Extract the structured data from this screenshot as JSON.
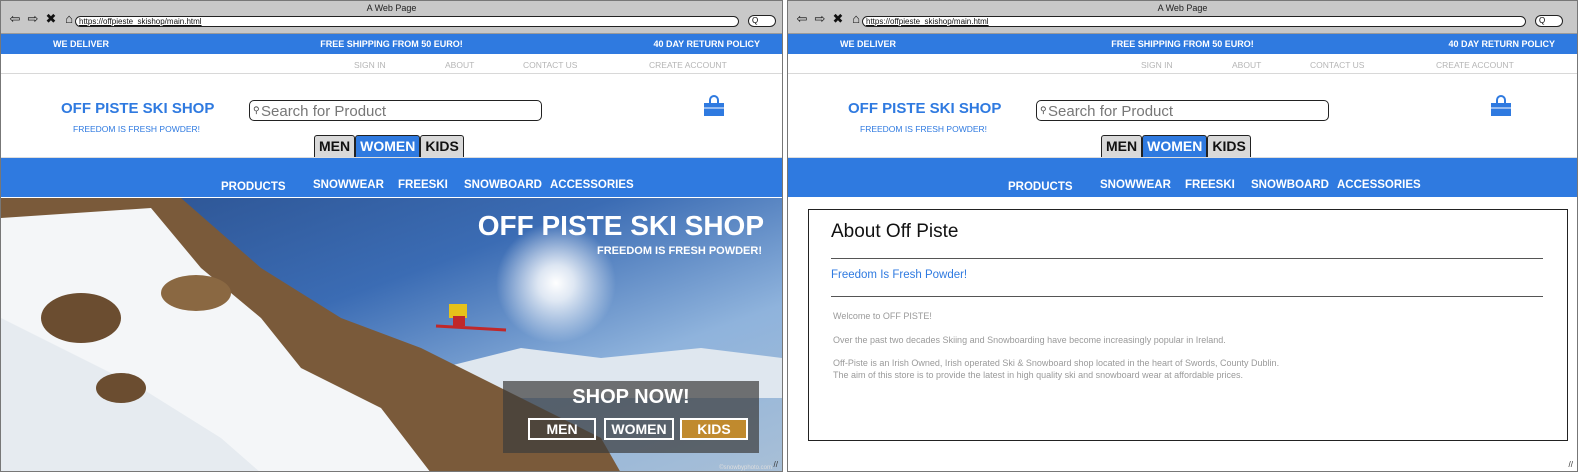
{
  "window": {
    "title": "A Web Page",
    "url": "https://offpieste_skishop/main.html",
    "search_btn": "Q"
  },
  "nav": {
    "back": "⇦",
    "forward": "⇨",
    "close": "✖",
    "home": "⌂"
  },
  "topbar": {
    "deliver": "WE DELIVER",
    "shipping": "FREE SHIPPING FROM 50 EURO!",
    "returns": "40 DAY RETURN POLICY"
  },
  "links": {
    "signin": "SIGN IN",
    "about": "ABOUT",
    "contact": "CONTACT US",
    "create": "CREATE ACCOUNT"
  },
  "header": {
    "shop_name": "OFF PISTE SKI SHOP",
    "tagline": "FREEDOM IS FRESH POWDER!",
    "search_placeholder": "Search for Product"
  },
  "tabs": [
    "MEN",
    "WOMEN",
    "KIDS"
  ],
  "menu": {
    "products": "PRODUCTS",
    "snowwear": "SNOWWEAR",
    "freeski": "FREESKI",
    "snowboard": "SNOWBOARD",
    "accessories": "ACCESSORIES"
  },
  "hero": {
    "title": "OFF PISTE SKI SHOP",
    "subtitle": "FREEDOM IS FRESH POWDER!",
    "shop_now": "SHOP NOW!",
    "men": "MEN",
    "women": "WOMEN",
    "kids": "KIDS",
    "credit": "©snowbyphoto.com"
  },
  "about": {
    "title": "About Off Piste",
    "subtitle": "Freedom Is Fresh Powder!",
    "p1": "Welcome to OFF PISTE!",
    "p2": "Over the past two decades Skiing and Snowboarding have become increasingly popular in Ireland.",
    "p3": "Off-Piste is an Irish Owned, Irish operated Ski & Snowboard shop located in the heart of Swords, County Dublin.",
    "p4": "The aim of this store is to provide the latest in high quality ski and snowboard wear at affordable prices."
  },
  "colors": {
    "brand": "#2f7ae0",
    "kids_button": "#c08a2e"
  }
}
